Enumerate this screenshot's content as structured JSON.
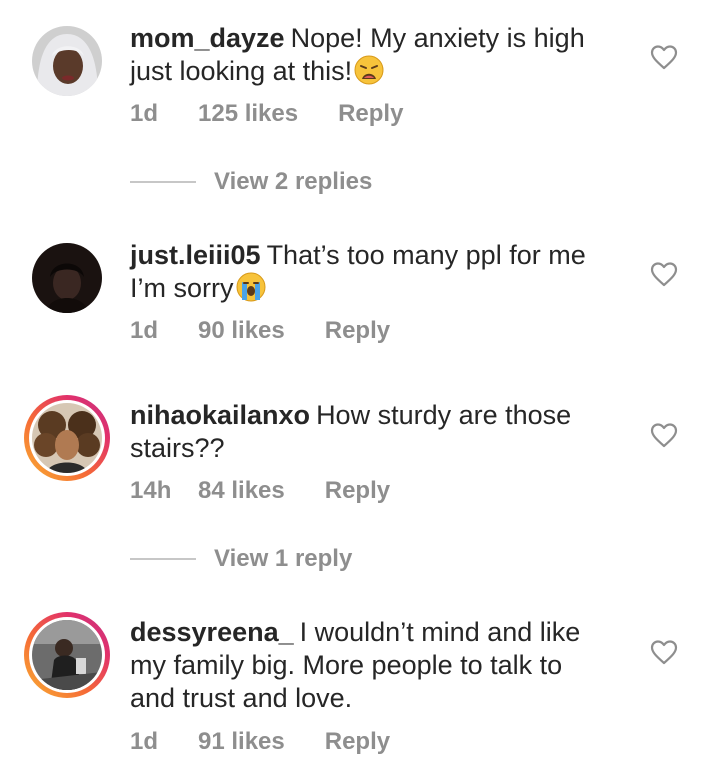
{
  "comments": [
    {
      "username": "mom_dayze",
      "text": "Nope! My anxiety is high just looking at this!",
      "emoji": "weary-face-emoji",
      "time": "1d",
      "likes": "125 likes",
      "reply_label": "Reply",
      "has_story_ring": false
    },
    {
      "username": "just.leiii05",
      "text": "That’s too many ppl for me I’m sorry",
      "emoji": "loudly-crying-face-emoji",
      "time": "1d",
      "likes": "90 likes",
      "reply_label": "Reply",
      "has_story_ring": false
    },
    {
      "username": "nihaokailanxo",
      "text": "How sturdy are those stairs??",
      "time": "14h",
      "likes": "84 likes",
      "reply_label": "Reply",
      "has_story_ring": true
    },
    {
      "username": "dessyreena_",
      "text": "I wouldn’t mind and like my family big. More people to talk to and trust and love.",
      "time": "1d",
      "likes": "91 likes",
      "reply_label": "Reply",
      "has_story_ring": true
    }
  ],
  "view_replies": [
    {
      "label": "View 2 replies"
    },
    {
      "label": "View 1 reply"
    }
  ],
  "icons": {
    "like": "heart-outline-icon"
  },
  "colors": {
    "text": "#262626",
    "secondary": "#8e8e8e",
    "story_ring_start": "#f9b233",
    "story_ring_end": "#c13584"
  }
}
